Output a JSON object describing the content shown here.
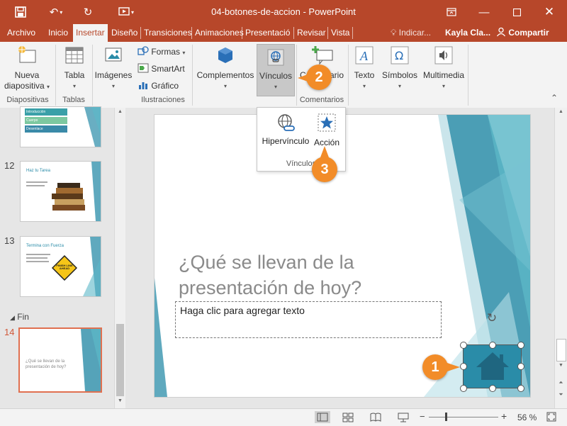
{
  "app": {
    "doc_title": "04-botones-de-accion  -  PowerPoint"
  },
  "tabs": [
    {
      "label": "Archivo"
    },
    {
      "label": "Inicio"
    },
    {
      "label": "Insertar"
    },
    {
      "label": "Diseño"
    },
    {
      "label": "Transiciones"
    },
    {
      "label": "Animaciones"
    },
    {
      "label": "Presentació"
    },
    {
      "label": "Revisar"
    },
    {
      "label": "Vista"
    }
  ],
  "tell_me": "Indicar...",
  "user_name": "Kayla Cla...",
  "share_label": "Compartir",
  "ribbon": {
    "nueva_line1": "Nueva",
    "nueva_line2": "diapositiva",
    "tabla": "Tabla",
    "imagenes": "Imágenes",
    "formas": "Formas",
    "smartart": "SmartArt",
    "grafico": "Gráfico",
    "complementos": "Complementos",
    "vinculos": "Vínculos",
    "comentario": "Comentario",
    "texto": "Texto",
    "simbolos": "Símbolos",
    "multimedia": "Multimedia",
    "groups": {
      "diapositivas": "Diapositivas",
      "tablas": "Tablas",
      "ilustraciones": "Ilustraciones",
      "comentarios": "Comentarios"
    }
  },
  "dropdown": {
    "hipervinculo": "Hipervínculo",
    "accion": "Acción",
    "group_label": "Vínculos"
  },
  "thumbnails": [
    {
      "number": "",
      "title": "",
      "items": [
        "Introducción",
        "Cuerpo",
        "Desenlace"
      ]
    },
    {
      "number": "12",
      "title": "Haz tu Tarea"
    },
    {
      "number": "13",
      "title": "Termina con Fuerza",
      "sign_text": "FINISH LINE AHEAD"
    },
    {
      "section": "Fin"
    },
    {
      "number": "14",
      "title": "¿Qué se llevan de la presentación de hoy?"
    }
  ],
  "slide": {
    "title": "¿Qué se llevan de la presentación de hoy?",
    "placeholder": "Haga clic para agregar texto"
  },
  "callouts": [
    "1",
    "2",
    "3"
  ],
  "status": {
    "zoom": "56 %"
  },
  "colors": {
    "accent": "#b7472a",
    "teal": "#2a8ca8",
    "callout": "#f28c28"
  }
}
